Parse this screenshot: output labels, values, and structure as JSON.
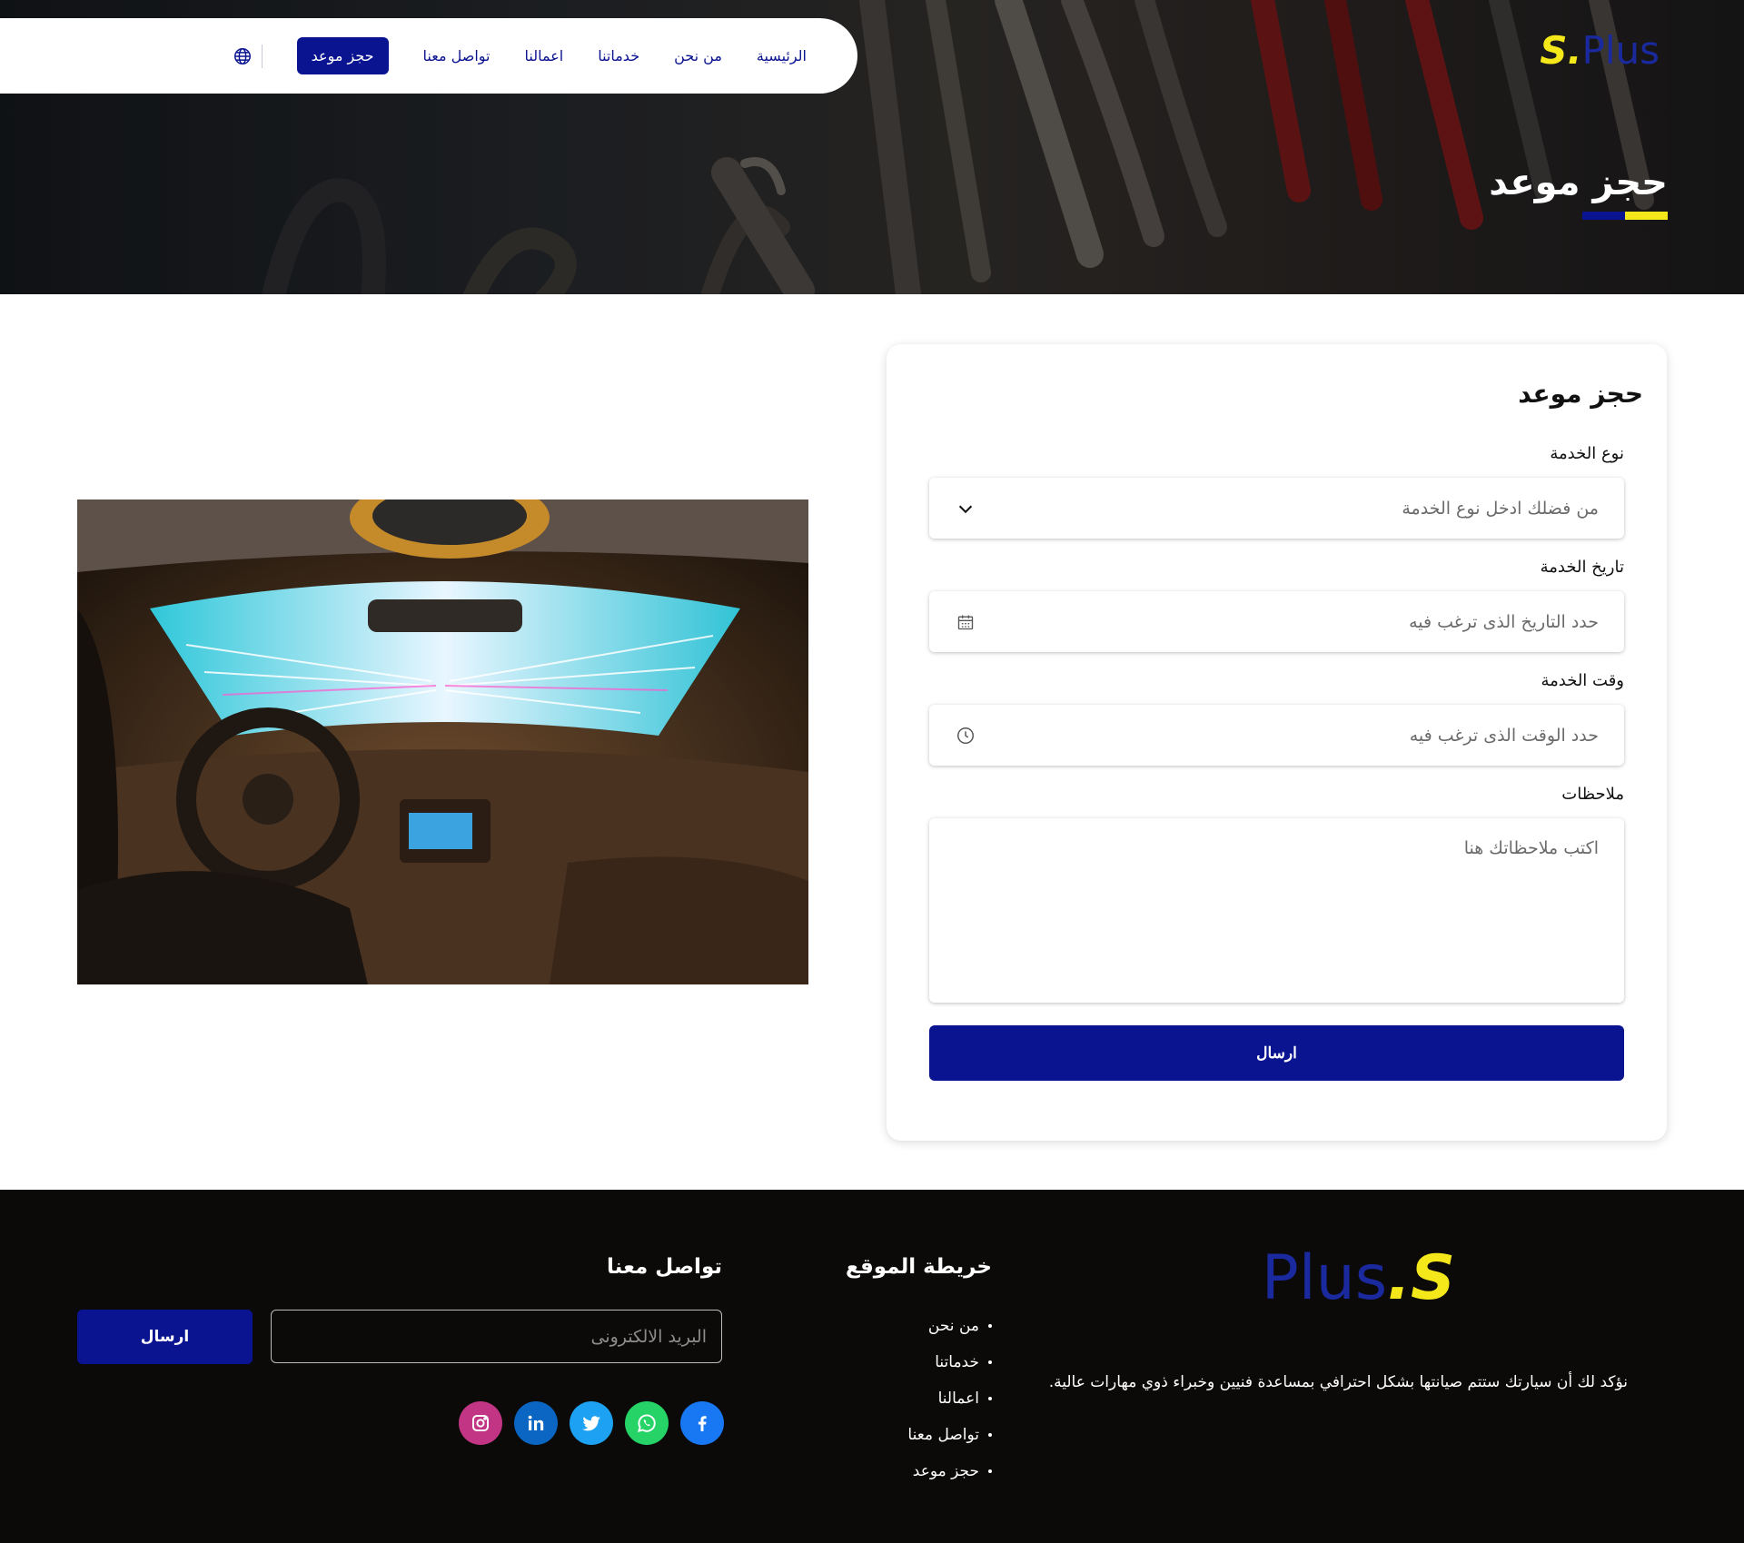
{
  "nav": {
    "items": [
      {
        "label": "الرئيسية"
      },
      {
        "label": "من نحن"
      },
      {
        "label": "خدماتنا"
      },
      {
        "label": "اعمالنا"
      },
      {
        "label": "تواصل معنا"
      }
    ],
    "cta_label": "حجز موعد",
    "language_icon": "globe-icon"
  },
  "brand": {
    "logo_mark": "S",
    "logo_dot": ".",
    "logo_word": "Plus",
    "colors": {
      "navy": "#0a1490",
      "yellow": "#f4e81b"
    }
  },
  "hero": {
    "title": "حجز موعد"
  },
  "form": {
    "title": "حجز موعد",
    "service_type": {
      "label": "نوع الخدمة",
      "placeholder": "من فضلك ادخل نوع الخدمة",
      "icon": "chevron-down-icon"
    },
    "service_date": {
      "label": "تاريخ الخدمة",
      "placeholder": "حدد التاريخ الذى ترغب فيه",
      "icon": "calendar-icon"
    },
    "service_time": {
      "label": "وقت الخدمة",
      "placeholder": "حدد الوقت الذى ترغب فيه",
      "icon": "clock-icon"
    },
    "notes": {
      "label": "ملاحظات",
      "placeholder": "اكتب ملاحظاتك هنا"
    },
    "submit_label": "ارسال"
  },
  "footer": {
    "tagline": "نؤكد لك أن سيارتك ستتم صيانتها بشكل احترافي بمساعدة فنيين وخبراء ذوي مهارات عالية.",
    "sitemap": {
      "title": "خريطة الموقع",
      "items": [
        "من نحن",
        "خدماتنا",
        "اعمالنا",
        "تواصل معنا",
        "حجز موعد"
      ]
    },
    "contact": {
      "title": "تواصل معنا",
      "email_placeholder": "البريد الالكترونى",
      "submit_label": "ارسال",
      "socials": [
        {
          "icon": "facebook-icon",
          "color": "#1877f2"
        },
        {
          "icon": "whatsapp-icon",
          "color": "#25d366"
        },
        {
          "icon": "twitter-icon",
          "color": "#1da1f2"
        },
        {
          "icon": "linkedin-icon",
          "color": "#0a66c2"
        },
        {
          "icon": "instagram-icon",
          "color": "#c13584"
        }
      ]
    }
  }
}
